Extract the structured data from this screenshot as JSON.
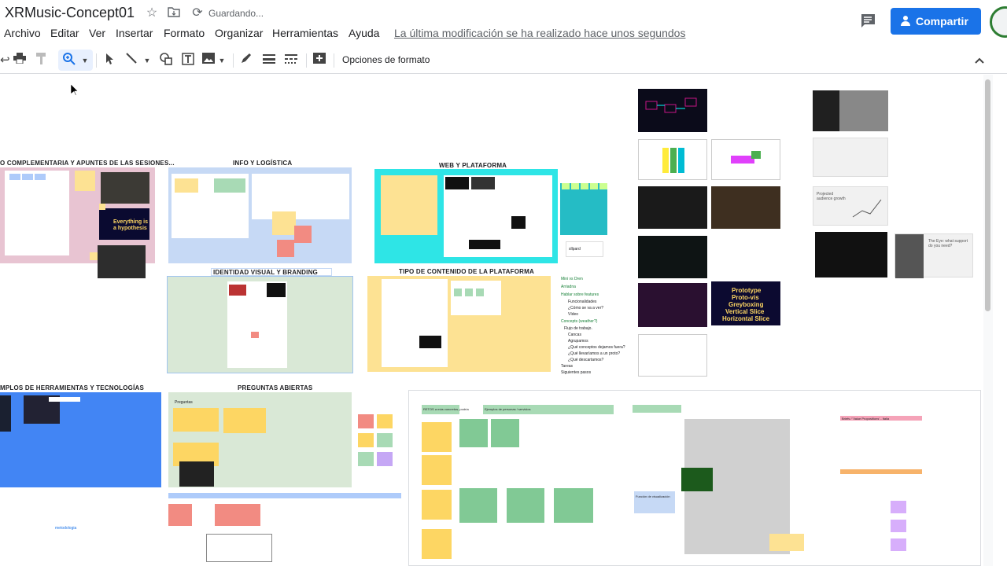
{
  "app": {
    "title": "XRMusic-Concept01",
    "saving_status": "Guardando...",
    "last_edit": "La última modificación se ha realizado hace unos segundos",
    "share_label": "Compartir",
    "accent": "#1a73e8"
  },
  "menu": [
    "Archivo",
    "Editar",
    "Ver",
    "Insertar",
    "Formato",
    "Organizar",
    "Herramientas",
    "Ayuda"
  ],
  "toolbar": {
    "format_options": "Opciones de formato",
    "icons": [
      "print-icon",
      "paint-format-icon",
      "zoom-icon",
      "select-icon",
      "line-icon",
      "shape-icon",
      "textbox-icon",
      "image-icon",
      "pen-icon",
      "line-weight-icon",
      "line-dash-icon",
      "add-comment-icon",
      "collapse-icon"
    ]
  },
  "canvas": {
    "sections": {
      "complementaria": "O COMPLEMENTARIA Y APUNTES DE LAS SESIONES...",
      "info": "INFO Y LOGÍSTICA",
      "web": "WEB Y PLATAFORMA",
      "identidad": "IDENTIDAD VISUAL Y BRANDING",
      "tipo": "TIPO DE CONTENIDO DE LA PLATAFORMA",
      "herramientas": "MPLOS DE HERRAMIENTAS Y TECNOLOGÍAS",
      "preguntas": "PREGUNTAS ABIERTAS"
    },
    "slide_text": {
      "hypothesis": "Everything is a hypothesis",
      "prototype": [
        "Prototype",
        "Proto-vis",
        "Greyboxing",
        "Vertical Slice",
        "Horizontal Slice"
      ],
      "audience": "Projected audience growth",
      "eyes": "The Eye: what support do you need?"
    },
    "list_items": [
      "Mini vs Dren",
      "Arriadna",
      "Hablar sobre features",
      "Funcionalidades",
      "¿Cómo se va a ver?",
      "Vídeo",
      "Concepts (weather?)",
      "Flujo de trabajo.",
      "Cancas",
      "Agrupamos",
      "¿Qué conceptos dejamos fuera?",
      "¿Qué llevaríamos a un proto?",
      "¿Qué descartamos?",
      "Tareas",
      "Siguientes pasos"
    ],
    "padlet": "sllpard",
    "preguntas_label": "Preguntas",
    "metodologia": "metodologia",
    "retos": "RETOS a más concretos, podría",
    "personas": "Ejemplos de personas / servicios",
    "briefs": "Briefs / 'Value Propositions' - Italia",
    "funciones": "Función de visualización"
  }
}
